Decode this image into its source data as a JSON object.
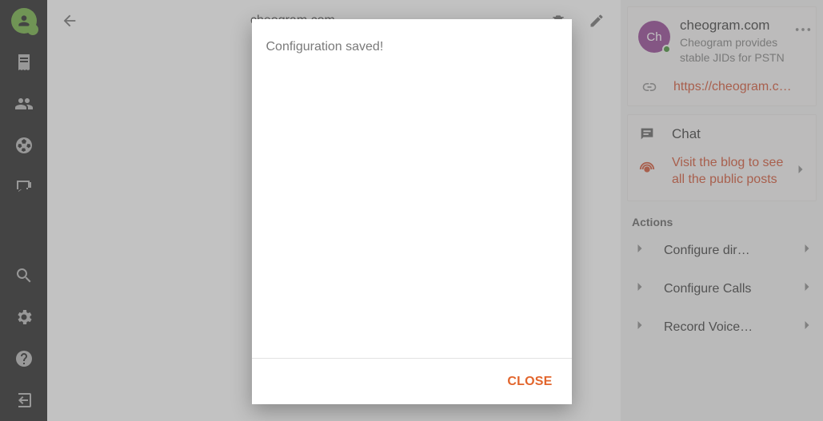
{
  "rail": {
    "items": [
      "receipt-icon",
      "people-icon",
      "sports-icon",
      "qa-icon"
    ],
    "bottom": [
      "search-icon",
      "settings-icon",
      "help-icon",
      "logout-icon"
    ]
  },
  "header": {
    "title": "cheogram.com"
  },
  "right": {
    "profile": {
      "avatar_initials": "Ch",
      "title": "cheogram.com",
      "subtitle": "Cheogram provides stable JIDs for PSTN",
      "url": "https://cheogram.c…"
    },
    "chat": {
      "label": "Chat",
      "blog_cta": "Visit the blog to see all the public posts"
    },
    "actions_label": "Actions",
    "actions": [
      {
        "label": "Configure dir…"
      },
      {
        "label": "Configure Calls"
      },
      {
        "label": "Record Voice…"
      }
    ]
  },
  "modal": {
    "message": "Configuration saved!",
    "close_label": "CLOSE"
  }
}
